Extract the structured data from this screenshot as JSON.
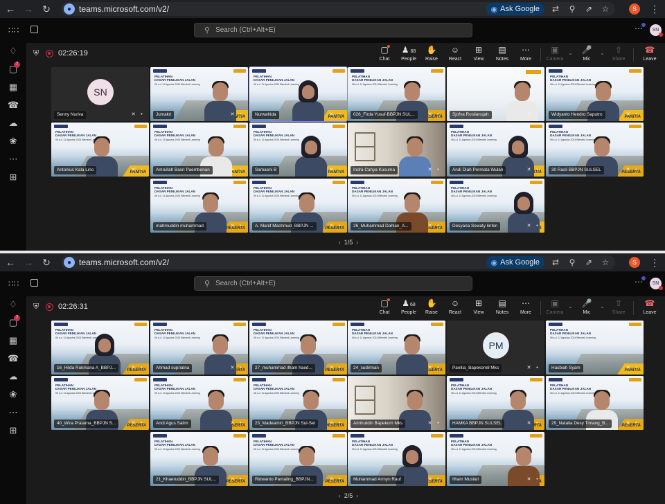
{
  "browser": {
    "url": "teams.microsoft.com/v2/",
    "ask_google": "Ask Google",
    "profile_initial": "S"
  },
  "teams": {
    "search_placeholder": "Search (Ctrl+Alt+E)",
    "user_initials": "SN",
    "rail_badge": "7"
  },
  "controls": {
    "chat": "Chat",
    "people": "People",
    "people_count": "68",
    "raise": "Raise",
    "react": "React",
    "view": "View",
    "notes": "Notes",
    "more": "More",
    "camera": "Camera",
    "mic": "Mic",
    "share": "Share",
    "leave": "Leave"
  },
  "slide": {
    "title_line1": "PELATIHAN",
    "title_line2": "DASAR PENILIKAN JALAN",
    "subtitle": "06 s.d. 11 Agustus 2024 Blended Learning",
    "role_panitia": "PANITIA",
    "role_peserta": "PESERTA"
  },
  "screens": [
    {
      "timer": "02:26:19",
      "pager": "1/5",
      "participants": [
        {
          "name": "Senny Nuriva",
          "kind": "avatar",
          "initials": "SN"
        },
        {
          "name": "Jumakri",
          "kind": "slide",
          "role": "panitia",
          "person": "headset"
        },
        {
          "name": "Nurwahida",
          "kind": "slide",
          "role": "panitia",
          "person": "hijab",
          "speaking": true
        },
        {
          "name": "026_Firda Yusuf-BBPJN SUL...",
          "kind": "slide",
          "role": "peserta",
          "person": "plain"
        },
        {
          "name": "Sjofva Rosliansjah",
          "kind": "bbpjn",
          "role": "",
          "person": "white"
        },
        {
          "name": "Widyanto Hendro Saputro",
          "kind": "slide",
          "role": "panitia",
          "person": "plain"
        },
        {
          "name": "Antonius Kala Lino",
          "kind": "slide",
          "role": "panitia",
          "person": "plain"
        },
        {
          "name": "Amrullah Basri Paembonan",
          "kind": "slide",
          "role": "panitia",
          "person": "white"
        },
        {
          "name": "Samaeni B",
          "kind": "slide",
          "role": "panitia",
          "person": "hijab"
        },
        {
          "name": "Indra Cahya Kusuma",
          "kind": "office",
          "role": "",
          "person": "blue"
        },
        {
          "name": "Andi Diah Permata Wulan",
          "kind": "slide",
          "role": "panitia",
          "person": "hijab"
        },
        {
          "name": "30 Rasli BBPJN SULSEL",
          "kind": "slide",
          "role": "peserta",
          "person": "plain"
        },
        {
          "name": "mahmuddin muhammad",
          "kind": "slide",
          "role": "peserta",
          "person": "plain"
        },
        {
          "name": "A. Manif Machmud_BBPJN ...",
          "kind": "slide",
          "role": "peserta",
          "person": "plain"
        },
        {
          "name": "26_Muhammad Dahlan_A...",
          "kind": "slide",
          "role": "peserta",
          "person": "batik"
        },
        {
          "name": "Desyana Sewaty Iinfen",
          "kind": "slide",
          "role": "panitia",
          "person": "hijab"
        }
      ]
    },
    {
      "timer": "02:26:31",
      "pager": "2/5",
      "participants": [
        {
          "name": "16_Hilda Rukmana A_BBPJ...",
          "kind": "slide",
          "role": "peserta",
          "person": "hijab"
        },
        {
          "name": "Ahmad supriatna",
          "kind": "slide",
          "role": "peserta",
          "person": "plain"
        },
        {
          "name": "27_muhammad ilham haed...",
          "kind": "slide",
          "role": "peserta",
          "person": "plain"
        },
        {
          "name": "24_sudirman",
          "kind": "slide",
          "role": "peserta",
          "person": "plain"
        },
        {
          "name": "Panitia_Bapekom8 Mks",
          "kind": "avatar",
          "initials": "PM"
        },
        {
          "name": "Hasbiah Syam",
          "kind": "slide",
          "role": "panitia",
          "person": "none"
        },
        {
          "name": "40_Wira Pratama_BBPJN S...",
          "kind": "slide",
          "role": "peserta",
          "person": "plain"
        },
        {
          "name": "Andi Agus Salim",
          "kind": "slide",
          "role": "peserta",
          "person": "plain"
        },
        {
          "name": "23_Madeamin_BBPJN Sul-Sel",
          "kind": "slide",
          "role": "peserta",
          "person": "plain"
        },
        {
          "name": "Amiruddin Bapekom Mks",
          "kind": "office",
          "role": "",
          "person": "plain"
        },
        {
          "name": "HAMKA BBPJN SULSEL",
          "kind": "slide",
          "role": "peserta",
          "person": "plain"
        },
        {
          "name": "29_Natalia Desy Timang_B...",
          "kind": "slide",
          "role": "peserta",
          "person": "white"
        },
        {
          "name": "21_Khaeruddin_BBPJN SUL...",
          "kind": "slide",
          "role": "peserta",
          "person": "plain"
        },
        {
          "name": "Ridwanto Pamaling_BBPJN...",
          "kind": "slide",
          "role": "peserta",
          "person": "plain"
        },
        {
          "name": "Muhammad Armyn Rauf",
          "kind": "slide",
          "role": "peserta",
          "person": "hijab"
        },
        {
          "name": "Ilham Mustari",
          "kind": "slide",
          "role": "peserta",
          "person": "batik"
        }
      ]
    }
  ]
}
